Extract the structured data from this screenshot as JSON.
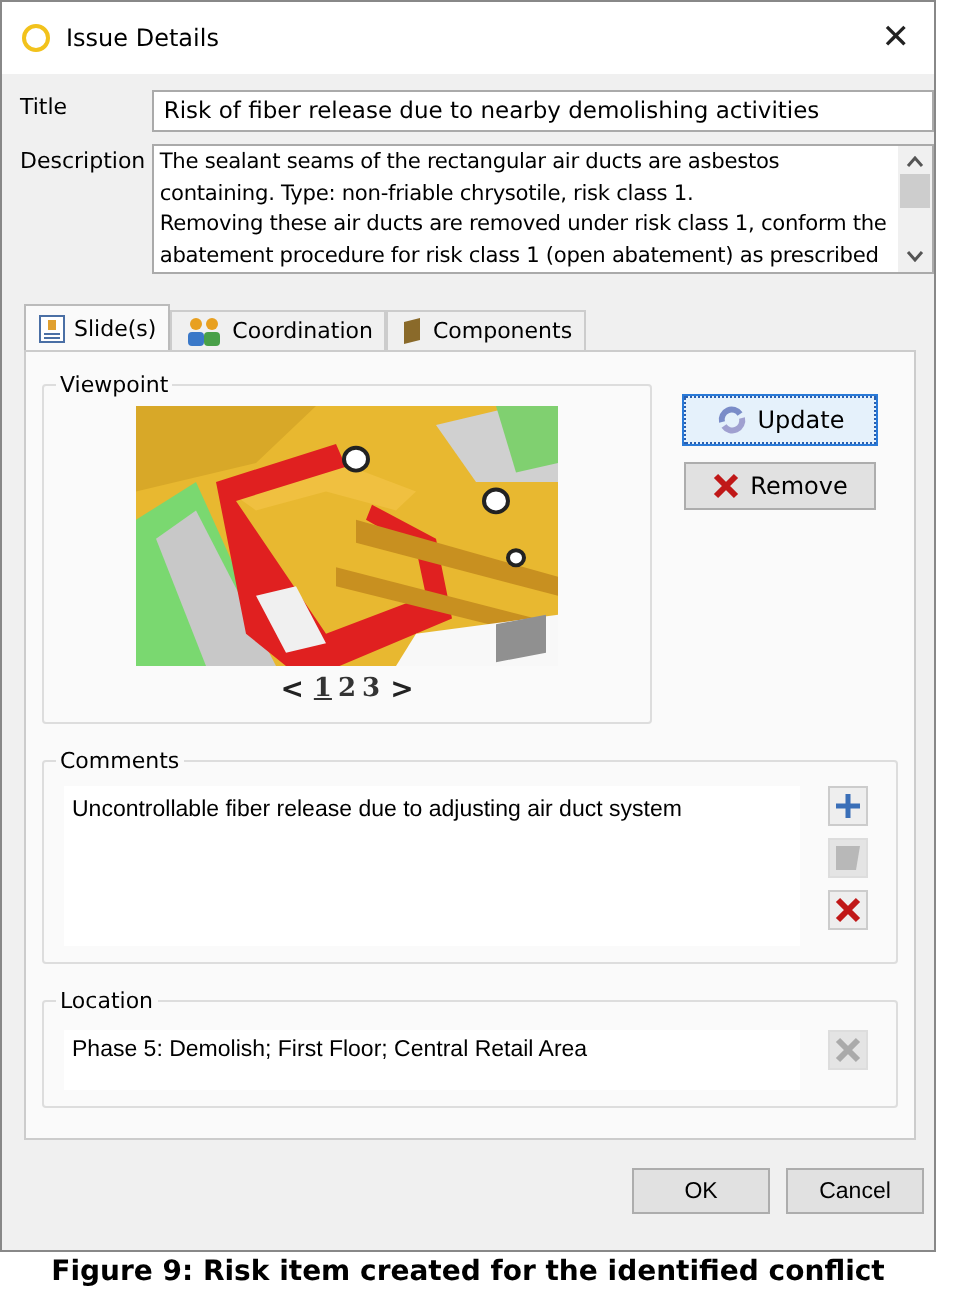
{
  "window": {
    "title": "Issue Details",
    "close": "✕"
  },
  "title_field": {
    "label": "Title",
    "value": "Risk of fiber release due to nearby demolishing activities"
  },
  "description": {
    "label": "Description",
    "lines": [
      "The sealant seams of the rectangular air ducts are asbestos",
      "containing. Type: non-friable chrysotile, risk class 1.",
      "Removing these air ducts are removed under risk class 1, conform the",
      "abatement procedure for risk class 1 (open abatement) as prescribed"
    ]
  },
  "tabs": [
    {
      "label": "Slide(s)",
      "kind": "slides",
      "selected": true
    },
    {
      "label": "Coordination",
      "kind": "people",
      "selected": false
    },
    {
      "label": "Components",
      "kind": "component",
      "selected": false
    }
  ],
  "viewpoint": {
    "label": "Viewpoint",
    "pager": [
      {
        "label": "<",
        "kind": "prev",
        "selected": false
      },
      {
        "label": "1",
        "kind": "page",
        "selected": true
      },
      {
        "label": "2",
        "kind": "page",
        "selected": false
      },
      {
        "label": "3",
        "kind": "page",
        "selected": false
      },
      {
        "label": ">",
        "kind": "next",
        "selected": false
      }
    ],
    "buttons": [
      {
        "label": "Update",
        "kind": "update"
      },
      {
        "label": "Remove",
        "kind": "remove"
      }
    ]
  },
  "comments": {
    "label": "Comments",
    "items": [
      "Uncontrollable fiber release due to adjusting air duct system"
    ],
    "tools": [
      {
        "kind": "add",
        "disabled": false
      },
      {
        "kind": "edit",
        "disabled": true
      },
      {
        "kind": "delete",
        "disabled": false
      }
    ]
  },
  "location": {
    "label": "Location",
    "value": "Phase 5: Demolish; First Floor; Central Retail Area",
    "remove_disabled": true
  },
  "buttons": [
    "OK",
    "Cancel"
  ],
  "caption": "Figure 9: Risk item created for the identified conflict"
}
